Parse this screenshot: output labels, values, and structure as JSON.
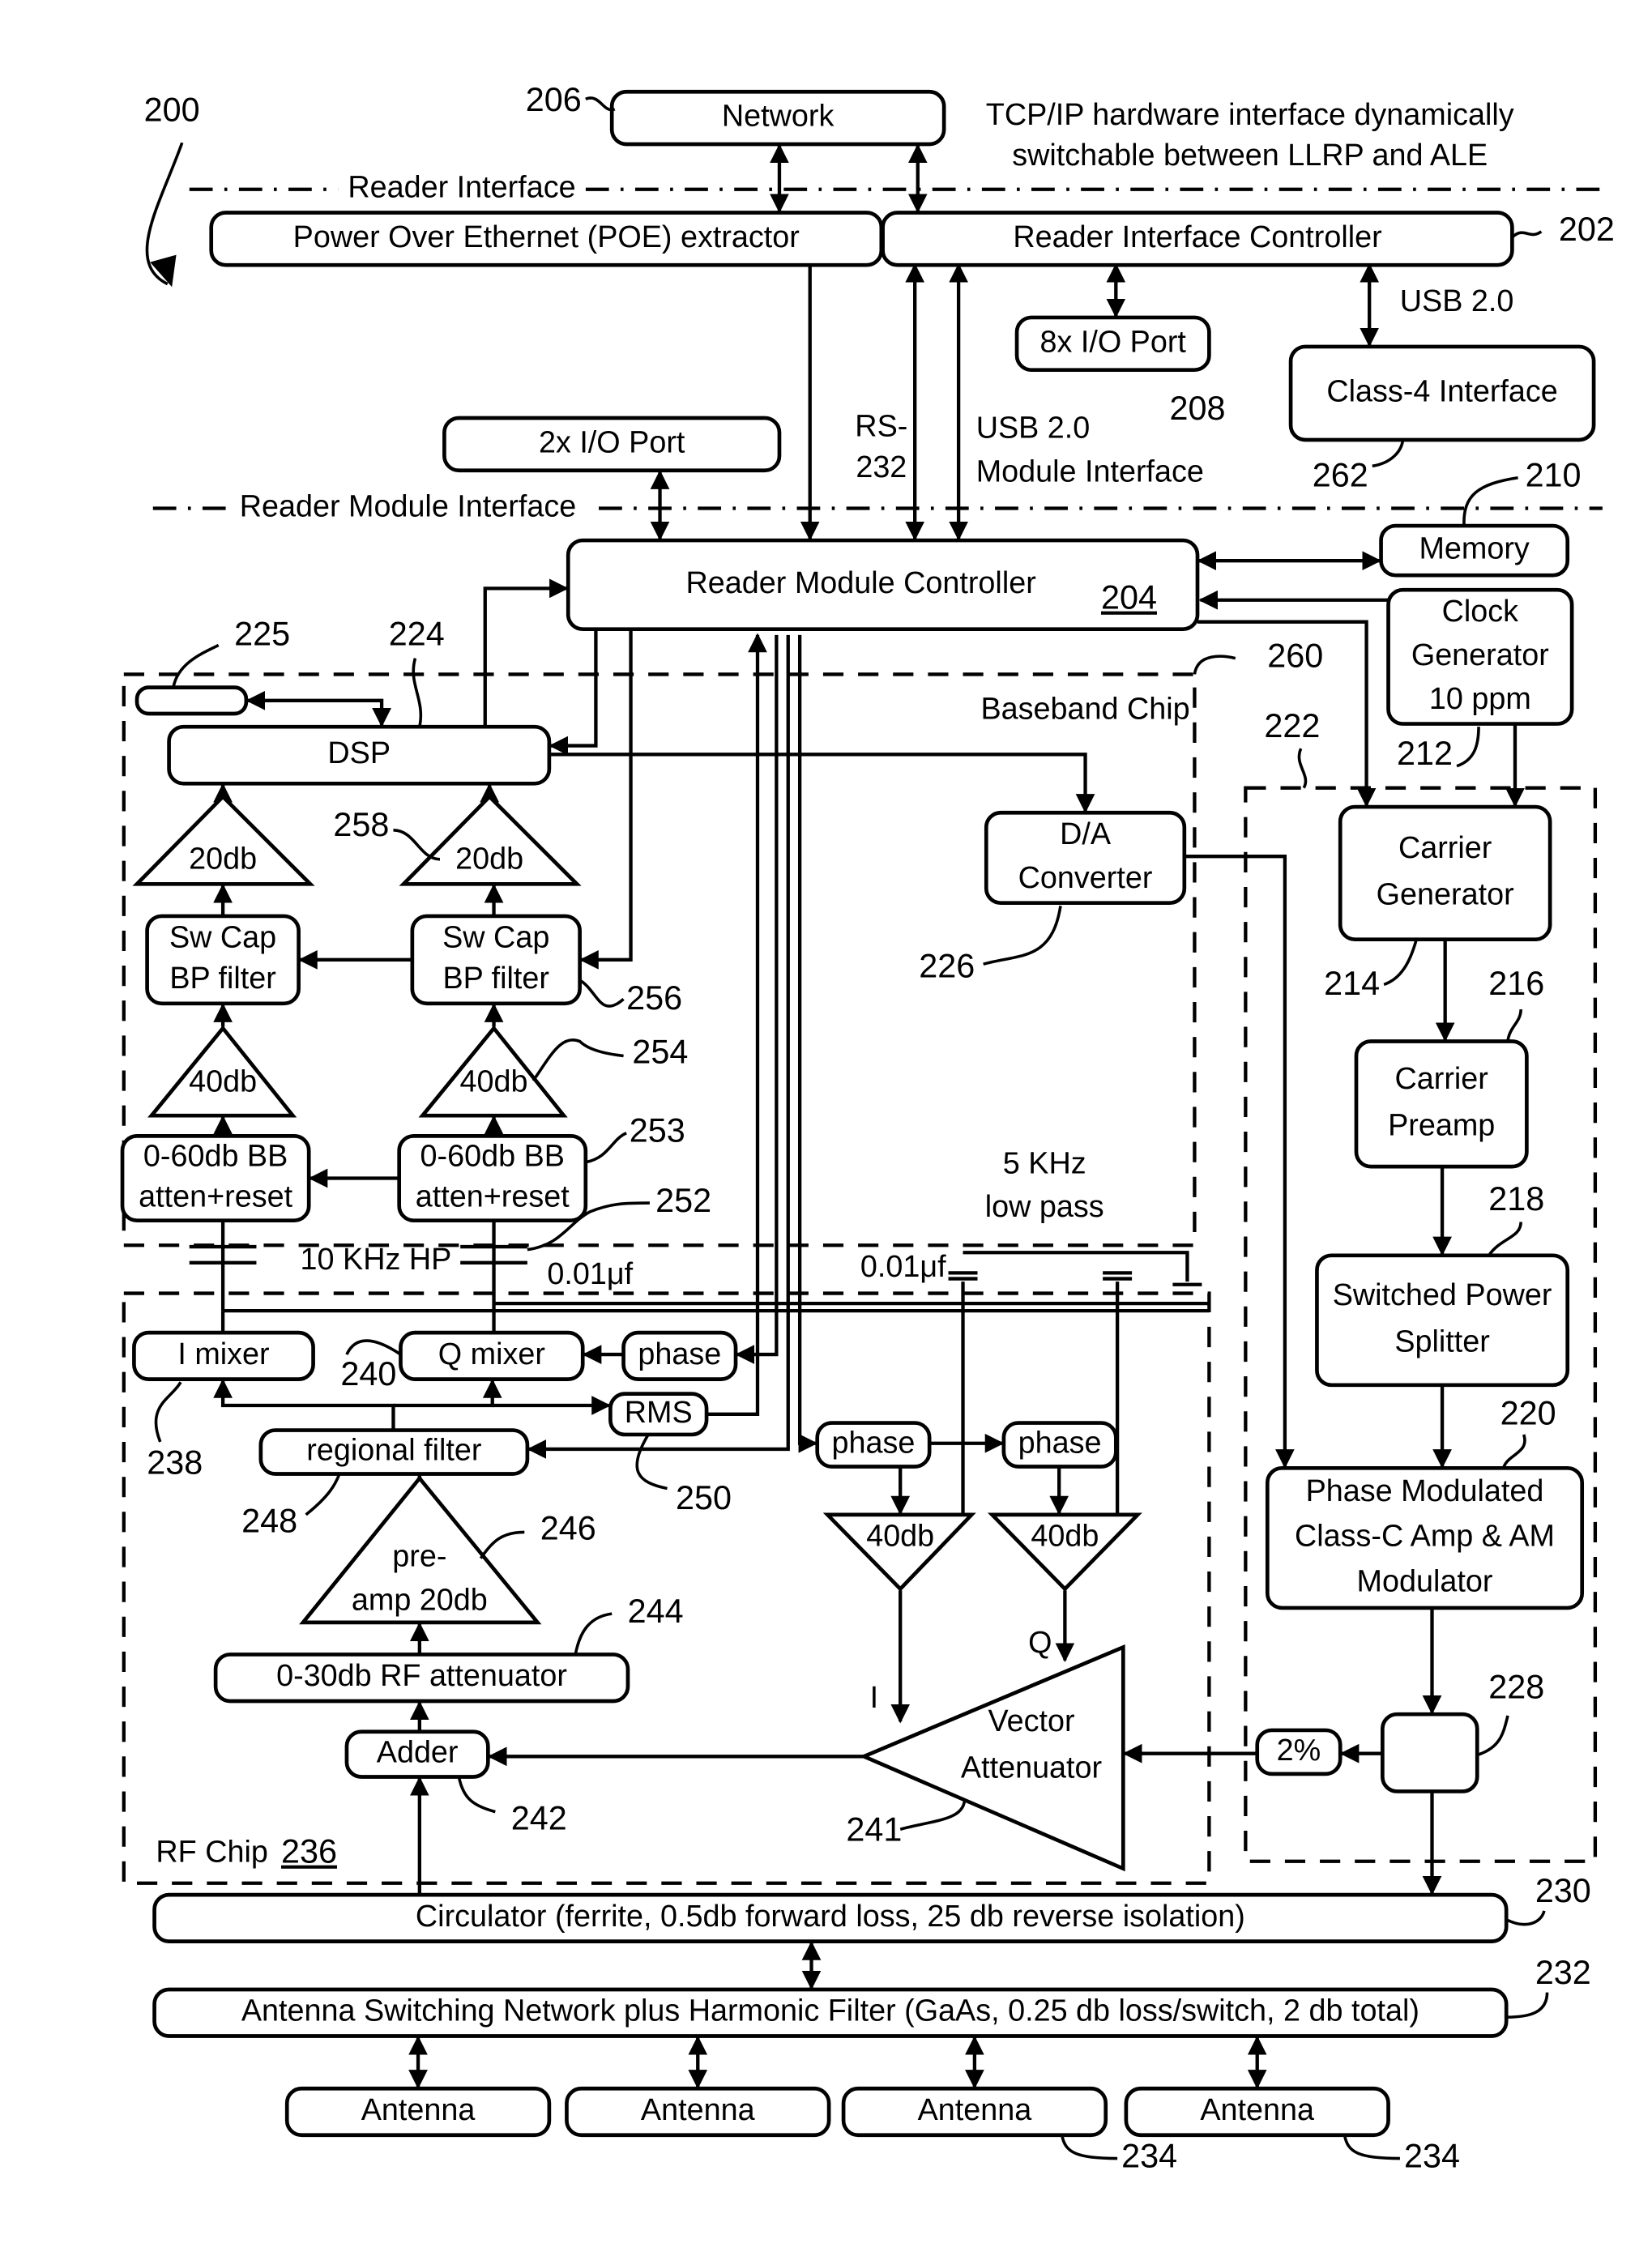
{
  "figure": {
    "number": "200",
    "title_note": [
      "TCP/IP hardware interface dynamically",
      "switchable between LLRP and ALE"
    ]
  },
  "boundaries": {
    "reader_interface": "Reader Interface",
    "reader_module_interface": "Reader Module Interface",
    "baseband_chip": "Baseband Chip",
    "baseband_chip_ref": "260",
    "rf_chip": "RF Chip",
    "rf_chip_ref": "236",
    "carrier_section_ref": "222"
  },
  "blocks": {
    "network": {
      "label": "Network",
      "ref": "206"
    },
    "poe": {
      "label": "Power Over Ethernet (POE) extractor"
    },
    "reader_interface_controller": {
      "label": "Reader Interface Controller",
      "ref": "202"
    },
    "io_8x": {
      "label": "8x I/O Port",
      "ref": "208"
    },
    "class4": {
      "label": "Class-4 Interface",
      "ref": "262"
    },
    "io_2x": {
      "label": "2x I/O Port"
    },
    "reader_module_controller": {
      "label": "Reader Module Controller",
      "ref": "204"
    },
    "memory": {
      "label": "Memory",
      "ref": "210"
    },
    "clock": {
      "label": [
        "Clock",
        "Generator",
        "10 ppm"
      ],
      "ref": "212"
    },
    "store_225": {
      "label": "",
      "ref": "225"
    },
    "dsp": {
      "label": "DSP",
      "ref": "224"
    },
    "amp20_i": {
      "label": "20db"
    },
    "amp20_q": {
      "label": "20db",
      "ref": "258"
    },
    "bpf_i": {
      "label": [
        "Sw Cap",
        "BP filter"
      ]
    },
    "bpf_q": {
      "label": [
        "Sw Cap",
        "BP filter"
      ],
      "ref": "256"
    },
    "amp40_i": {
      "label": "40db"
    },
    "amp40_q": {
      "label": "40db",
      "ref": "254"
    },
    "atten_i": {
      "label": [
        "0-60db BB",
        "atten+reset"
      ]
    },
    "atten_q": {
      "label": [
        "0-60db BB",
        "atten+reset"
      ],
      "ref": "253"
    },
    "hp_note": {
      "label": "10 KHz HP",
      "cap": "0.01μf",
      "ref": "252"
    },
    "da": {
      "label": [
        "D/A",
        "Converter"
      ],
      "ref": "226"
    },
    "lowpass_note": {
      "label": [
        "5 KHz",
        "low pass"
      ],
      "cap": "0.01μf"
    },
    "i_mixer": {
      "label": "I mixer",
      "ref": "238"
    },
    "q_mixer": {
      "label": "Q mixer",
      "ref": "240"
    },
    "phase_q": {
      "label": "phase"
    },
    "rms": {
      "label": "RMS",
      "ref": "250"
    },
    "regional_filter": {
      "label": "regional filter",
      "ref": "248"
    },
    "phase_1": {
      "label": "phase"
    },
    "phase_2": {
      "label": "phase"
    },
    "amp40_tx_i": {
      "label": "40db"
    },
    "amp40_tx_q": {
      "label": "40db"
    },
    "preamp": {
      "label": [
        "pre-",
        "amp 20db"
      ],
      "ref": "246"
    },
    "rf_atten": {
      "label": "0-30db RF attenuator",
      "ref": "244"
    },
    "adder": {
      "label": "Adder",
      "ref": "242"
    },
    "vector_atten": {
      "label": [
        "Vector",
        "Attenuator"
      ],
      "ref": "241",
      "in_i": "I",
      "in_q": "Q"
    },
    "carrier_gen": {
      "label": [
        "Carrier",
        "Generator"
      ],
      "ref": "214"
    },
    "carrier_preamp": {
      "label": [
        "Carrier",
        "Preamp"
      ],
      "ref": "216"
    },
    "splitter": {
      "label": [
        "Switched Power",
        "Splitter"
      ],
      "ref": "218"
    },
    "class_c": {
      "label": [
        "Phase Modulated",
        "Class-C Amp & AM",
        "Modulator"
      ],
      "ref": "220"
    },
    "coupler": {
      "label": "",
      "ref": "228"
    },
    "two_pct": {
      "label": "2%"
    },
    "circulator": {
      "label": "Circulator (ferrite, 0.5db forward loss, 25 db reverse isolation)",
      "ref": "230"
    },
    "antenna_switch": {
      "label": "Antenna Switching Network plus Harmonic Filter (GaAs, 0.25 db loss/switch, 2 db total)",
      "ref": "232"
    },
    "antennas": [
      {
        "label": "Antenna"
      },
      {
        "label": "Antenna"
      },
      {
        "label": "Antenna",
        "ref": "234"
      },
      {
        "label": "Antenna",
        "ref": "234"
      }
    ]
  },
  "links": {
    "rs232": [
      "RS-",
      "232"
    ],
    "usb_module": [
      "USB 2.0",
      "Module Interface"
    ],
    "usb_class4": "USB 2.0"
  }
}
